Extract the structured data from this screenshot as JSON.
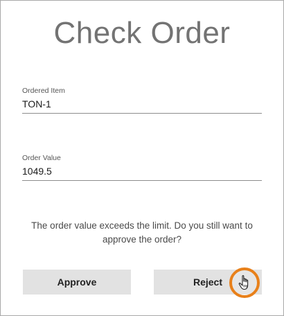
{
  "dialog": {
    "title": "Check Order",
    "fields": {
      "ordered_item": {
        "label": "Ordered Item",
        "value": "TON-1"
      },
      "order_value": {
        "label": "Order Value",
        "value": "1049.5"
      }
    },
    "message": "The order value exceeds the limit. Do you still want to approve the order?",
    "buttons": {
      "approve_label": "Approve",
      "reject_label": "Reject"
    }
  },
  "cursor": {
    "icon": "hand-pointer-icon",
    "highlight_color": "#e8801a"
  }
}
